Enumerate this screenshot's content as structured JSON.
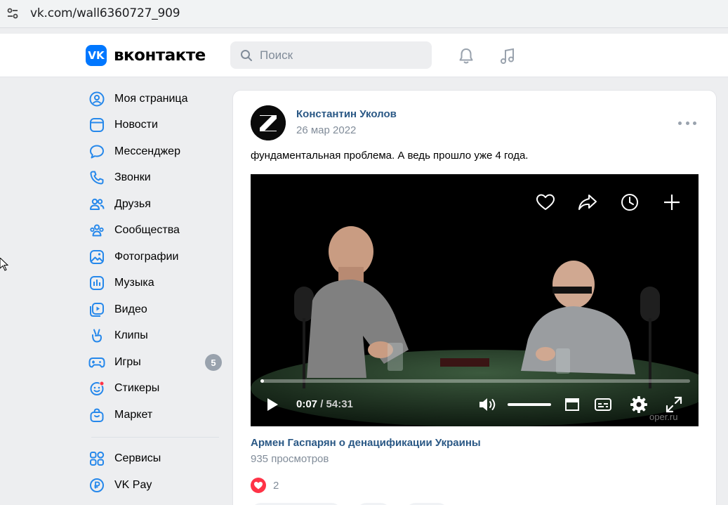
{
  "browser": {
    "url": "vk.com/wall6360727_909"
  },
  "header": {
    "logo_mark": "VK",
    "logo_text": "вконтакте",
    "search_placeholder": "Поиск",
    "icons": [
      "bell-icon",
      "music-note-icon"
    ]
  },
  "sidebar": {
    "items": [
      {
        "label": "Моя страница",
        "icon": "user-circle-icon"
      },
      {
        "label": "Новости",
        "icon": "newspaper-icon"
      },
      {
        "label": "Мессенджер",
        "icon": "message-bubble-icon"
      },
      {
        "label": "Звонки",
        "icon": "phone-icon"
      },
      {
        "label": "Друзья",
        "icon": "friends-icon"
      },
      {
        "label": "Сообщества",
        "icon": "communities-icon"
      },
      {
        "label": "Фотографии",
        "icon": "photo-icon"
      },
      {
        "label": "Музыка",
        "icon": "music-icon"
      },
      {
        "label": "Видео",
        "icon": "video-icon"
      },
      {
        "label": "Клипы",
        "icon": "clips-icon"
      },
      {
        "label": "Игры",
        "icon": "gamepad-icon",
        "badge": "5"
      },
      {
        "label": "Стикеры",
        "icon": "sticker-icon"
      },
      {
        "label": "Маркет",
        "icon": "market-bag-icon"
      }
    ],
    "secondary": [
      {
        "label": "Сервисы",
        "icon": "services-grid-icon"
      },
      {
        "label": "VK Pay",
        "icon": "vkpay-icon"
      }
    ]
  },
  "post": {
    "author": "Константин Уколов",
    "date": "26 мар 2022",
    "text": "фундаментальная проблема. А ведь прошло уже 4 года.",
    "video": {
      "current_time": "0:07",
      "duration": "/ 54:31",
      "progress": 0.002,
      "watermark": "oper.ru",
      "title": "Армен Гаспарян о денацификации Украины",
      "views": "935 просмотров"
    },
    "likes": "2"
  },
  "colors": {
    "accent": "#0077ff",
    "link": "#2a5885",
    "secondary_text": "#818c99",
    "like_red": "#ff3347"
  }
}
